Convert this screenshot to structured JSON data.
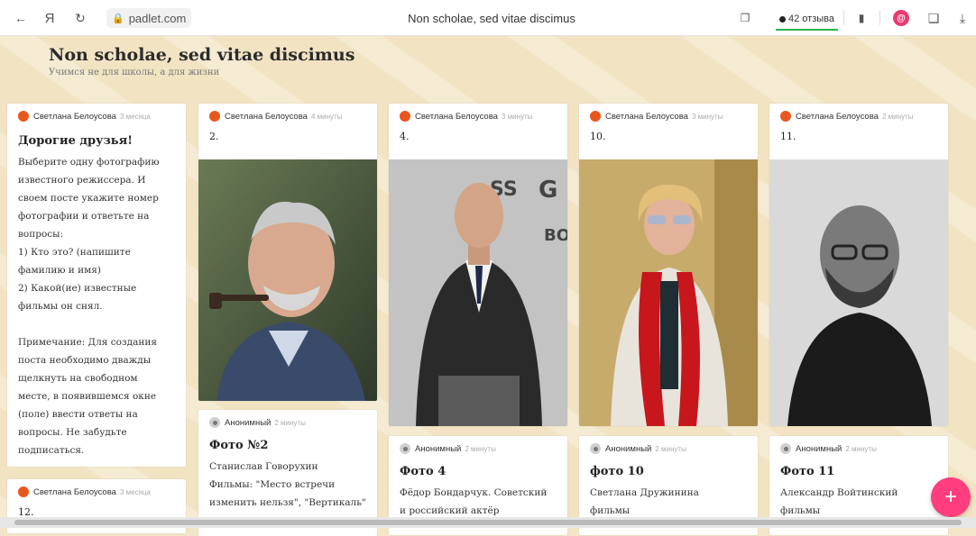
{
  "browser": {
    "url": "padlet.com",
    "tab_title": "Non scholae, sed vitae discimus",
    "reviews": "42 отзыва",
    "yandex_glyph": "Я"
  },
  "wall": {
    "title": "Non scholae, sed vitae discimus",
    "subtitle": "Учимся не для школы, а для жизни"
  },
  "cards": [
    {
      "author": "Светлана Белоусова",
      "time": "3 месяца",
      "title": "Дорогие друзья!",
      "body": "Выберите одну фотографию\nизвестного режиссера. И\nсвоем посте укажите номер\nфотографии и ответьте на\nвопросы:\n1) Кто это? (напишите\nфамилию и имя)\n2) Какой(ие) известные\nфильмы он снял.\n\nПримечание: Для создания\nпоста необходимо дважды\nщелкнуть на свободном\nместе, в появившемся окне\n(поле) ввести ответы на\nвопросы. Не забудьте\nподписаться."
    },
    {
      "author": "Светлана Белоусова",
      "time": "3 месяца",
      "num": "12."
    },
    {
      "author": "Светлана Белоусова",
      "time": "4 минуты",
      "num": "2."
    },
    {
      "author": "Анонимный",
      "time": "2 минуты",
      "title": "Фото №2",
      "body": "Станислав Говорухин\nФильмы: \"Место встречи\nизменить нельзя\", \"Вертикаль\""
    },
    {
      "author": "Светлана Белоусова",
      "time": "3 минуты",
      "num": "4."
    },
    {
      "author": "Анонимный",
      "time": "2 минуты",
      "title": "Фото 4",
      "body": "Фёдор Бондарчук. Советский\nи российский актёр"
    },
    {
      "author": "Светлана Белоусова",
      "time": "3 минуты",
      "num": "10."
    },
    {
      "author": "Анонимный",
      "time": "2 минуты",
      "title": "фото 10",
      "body": "Светлана Дружинина\nфильмы"
    },
    {
      "author": "Светлана Белоусова",
      "time": "2 минуты",
      "num": "11."
    },
    {
      "author": "Анонимный",
      "time": "2 минуты",
      "title": "Фото 11",
      "body": "Александр Войтинский\nфильмы"
    }
  ],
  "fab_label": "+",
  "colors": {
    "wall_bg": "#f2e3c3",
    "fab": "#ff3d7f",
    "avatar": "#e8571f",
    "review_underline": "#2bb24c"
  }
}
